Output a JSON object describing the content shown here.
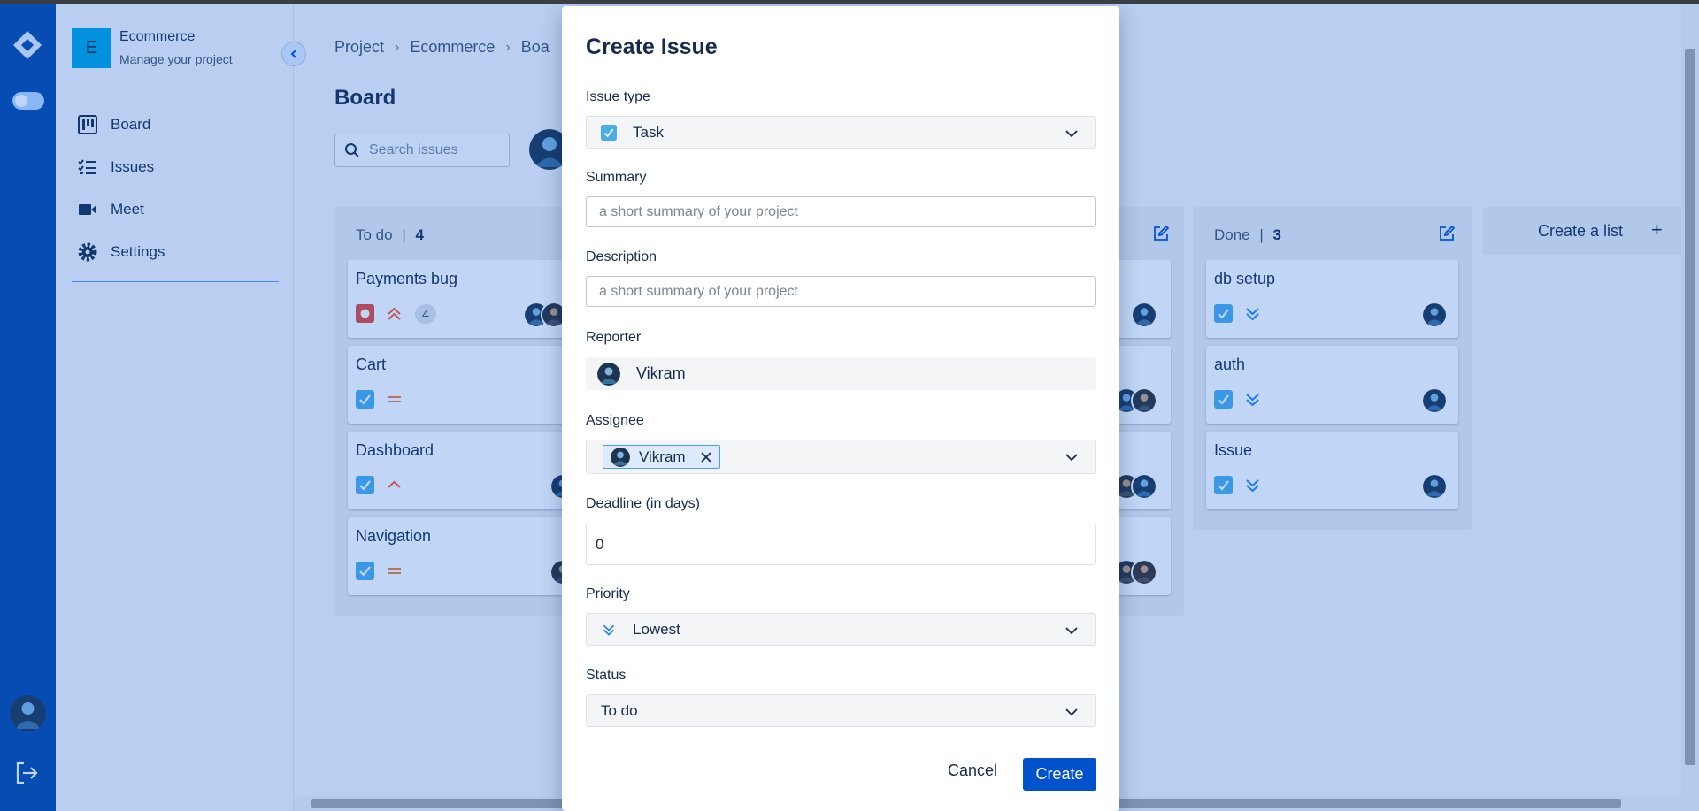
{
  "project": {
    "initial": "E",
    "name": "Ecommerce",
    "subtitle": "Manage your project"
  },
  "nav": {
    "board": "Board",
    "issues": "Issues",
    "meet": "Meet",
    "settings": "Settings"
  },
  "breadcrumb": {
    "project": "Project",
    "ecommerce": "Ecommerce",
    "board_partial": "Boa",
    "separator": "›"
  },
  "board": {
    "title": "Board",
    "search_placeholder": "Search issues"
  },
  "lists": {
    "todo": {
      "name": "To do",
      "count": "4",
      "cards": [
        {
          "title": "Payments bug",
          "type": "bug",
          "priority": "highest",
          "badge": "4"
        },
        {
          "title": "Cart",
          "type": "task",
          "priority": "medium"
        },
        {
          "title": "Dashboard",
          "type": "task",
          "priority": "high"
        },
        {
          "title": "Navigation",
          "type": "task",
          "priority": "medium"
        }
      ]
    },
    "done": {
      "name": "Done",
      "count": "3",
      "cards": [
        {
          "title": "db setup",
          "type": "task",
          "priority": "lowest"
        },
        {
          "title": "auth",
          "type": "task",
          "priority": "lowest"
        },
        {
          "title": "Issue",
          "type": "task",
          "priority": "lowest"
        }
      ]
    },
    "create_list": {
      "label": "Create a list",
      "plus": "+"
    },
    "count_separator": "|"
  },
  "modal": {
    "title": "Create Issue",
    "issue_type": {
      "label": "Issue type",
      "value": "Task",
      "icon": "task-checkbox-icon"
    },
    "summary": {
      "label": "Summary",
      "placeholder": "a short summary of your project"
    },
    "description": {
      "label": "Description",
      "placeholder": "a short summary of your project"
    },
    "reporter": {
      "label": "Reporter",
      "value": "Vikram"
    },
    "assignee": {
      "label": "Assignee",
      "value": "Vikram"
    },
    "deadline": {
      "label": "Deadline (in days)",
      "value": "0"
    },
    "priority": {
      "label": "Priority",
      "value": "Lowest",
      "icon": "lowest-priority-icon"
    },
    "status": {
      "label": "Status",
      "value": "To do"
    },
    "cancel": "Cancel",
    "create": "Create"
  },
  "colors": {
    "rail": "#0747a6",
    "accent": "#0052cc",
    "task": "#4bade8",
    "bug": "#e5493a",
    "lowest": "#2684ff",
    "medium": "#e97f33",
    "overlay": "rgba(9,90,220,0.25)"
  }
}
